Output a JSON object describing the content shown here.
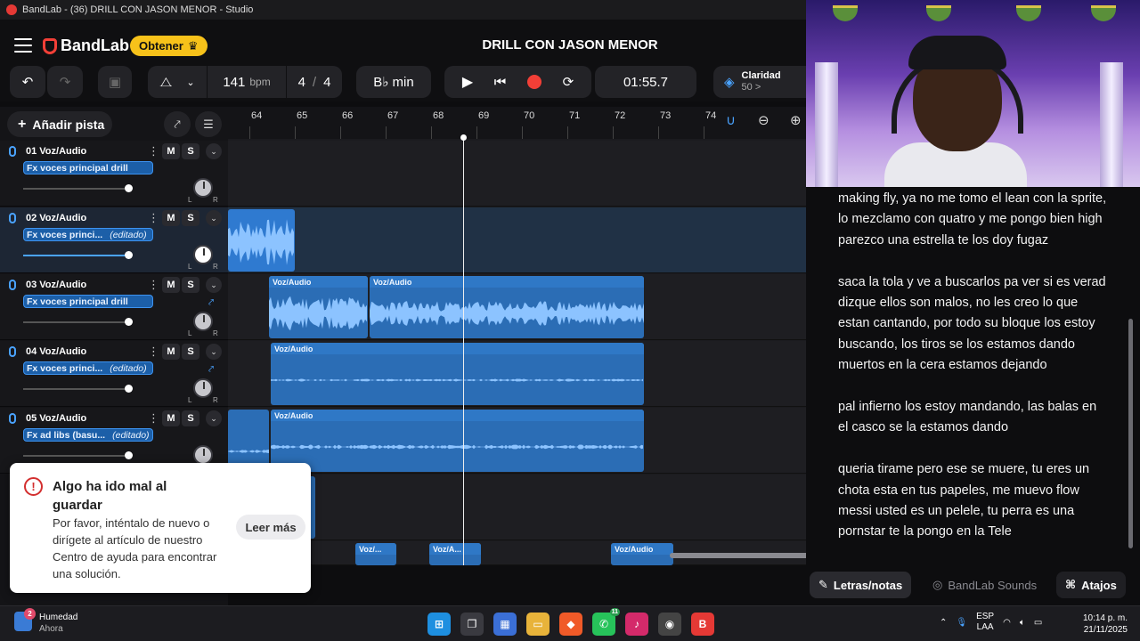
{
  "window": {
    "title": "BandLab - (36) DRILL CON JASON MENOR - Studio"
  },
  "header": {
    "brand": "BandLab",
    "obtener_label": "Obtener",
    "song_title": "DRILL CON JASON MENOR"
  },
  "transport": {
    "bpm": "141",
    "bpm_unit": "bpm",
    "time_sig_top": "4",
    "time_sig_sep": "/",
    "time_sig_bottom": "4",
    "key": "B♭ min",
    "time": "01:55.7",
    "claridad_label": "Claridad",
    "claridad_value": "50 >"
  },
  "tracklist": {
    "add_label": "Añadir pista",
    "tracks": [
      {
        "name": "01  Voz/Audio",
        "fx": "Fx voces principal drill",
        "edited": ""
      },
      {
        "name": "02  Voz/Audio",
        "fx": "Fx voces princi...",
        "edited": "(editado)"
      },
      {
        "name": "03  Voz/Audio",
        "fx": "Fx voces principal drill",
        "edited": ""
      },
      {
        "name": "04  Voz/Audio",
        "fx": "Fx voces princi...",
        "edited": "(editado)"
      },
      {
        "name": "05  Voz/Audio",
        "fx": "Fx ad libs (basu...",
        "edited": "(editado)"
      }
    ],
    "mute_label": "M",
    "solo_label": "S",
    "pan_l": "L",
    "pan_r": "R"
  },
  "ruler": {
    "bars": [
      "64",
      "65",
      "66",
      "67",
      "68",
      "69",
      "70",
      "71",
      "72",
      "73",
      "74"
    ]
  },
  "clips": {
    "label": "Voz/Audio",
    "short1": "Voz/...",
    "short2": "Voz/A..."
  },
  "toast": {
    "title": "Algo ha ido mal al guardar",
    "body": "Por favor, inténtalo de nuevo o dirígete al artículo de nuestro Centro de ayuda para encontrar una solución.",
    "action": "Leer más"
  },
  "lyrics": {
    "p1": "making fly, ya no me tomo el lean con la sprite, lo mezclamo con quatro y me pongo bien high parezco una estrella te los doy fugaz",
    "p2": "saca la tola y ve a buscarlos pa ver si es verad dizque ellos son malos, no les creo lo que estan cantando, por todo su bloque los estoy buscando, los tiros se los estamos dando muertos en la cera estamos dejando",
    "p3": "pal infierno los estoy mandando, las balas en el casco se la estamos dando",
    "p4": "queria tirame pero ese se muere, tu eres un chota esta en tus papeles, me muevo flow messi usted es un pelele, tu perra es una pornstar te la pongo en la Tele"
  },
  "panel_tabs": {
    "lyrics_tab": "Letras/notas",
    "sounds_tab": "BandLab Sounds",
    "shortcuts_tab": "Atajos"
  },
  "taskbar": {
    "weather_title": "Humedad",
    "weather_sub": "Ahora",
    "weather_badge": "2",
    "whatsapp_badge": "11",
    "lang_top": "ESP",
    "lang_bottom": "LAA",
    "time": "10:14 p. m.",
    "date": "21/11/2025"
  },
  "colors": {
    "accent_blue": "#3d93f0",
    "record_red": "#f23f37",
    "obtener_yellow": "#f7c21a"
  }
}
